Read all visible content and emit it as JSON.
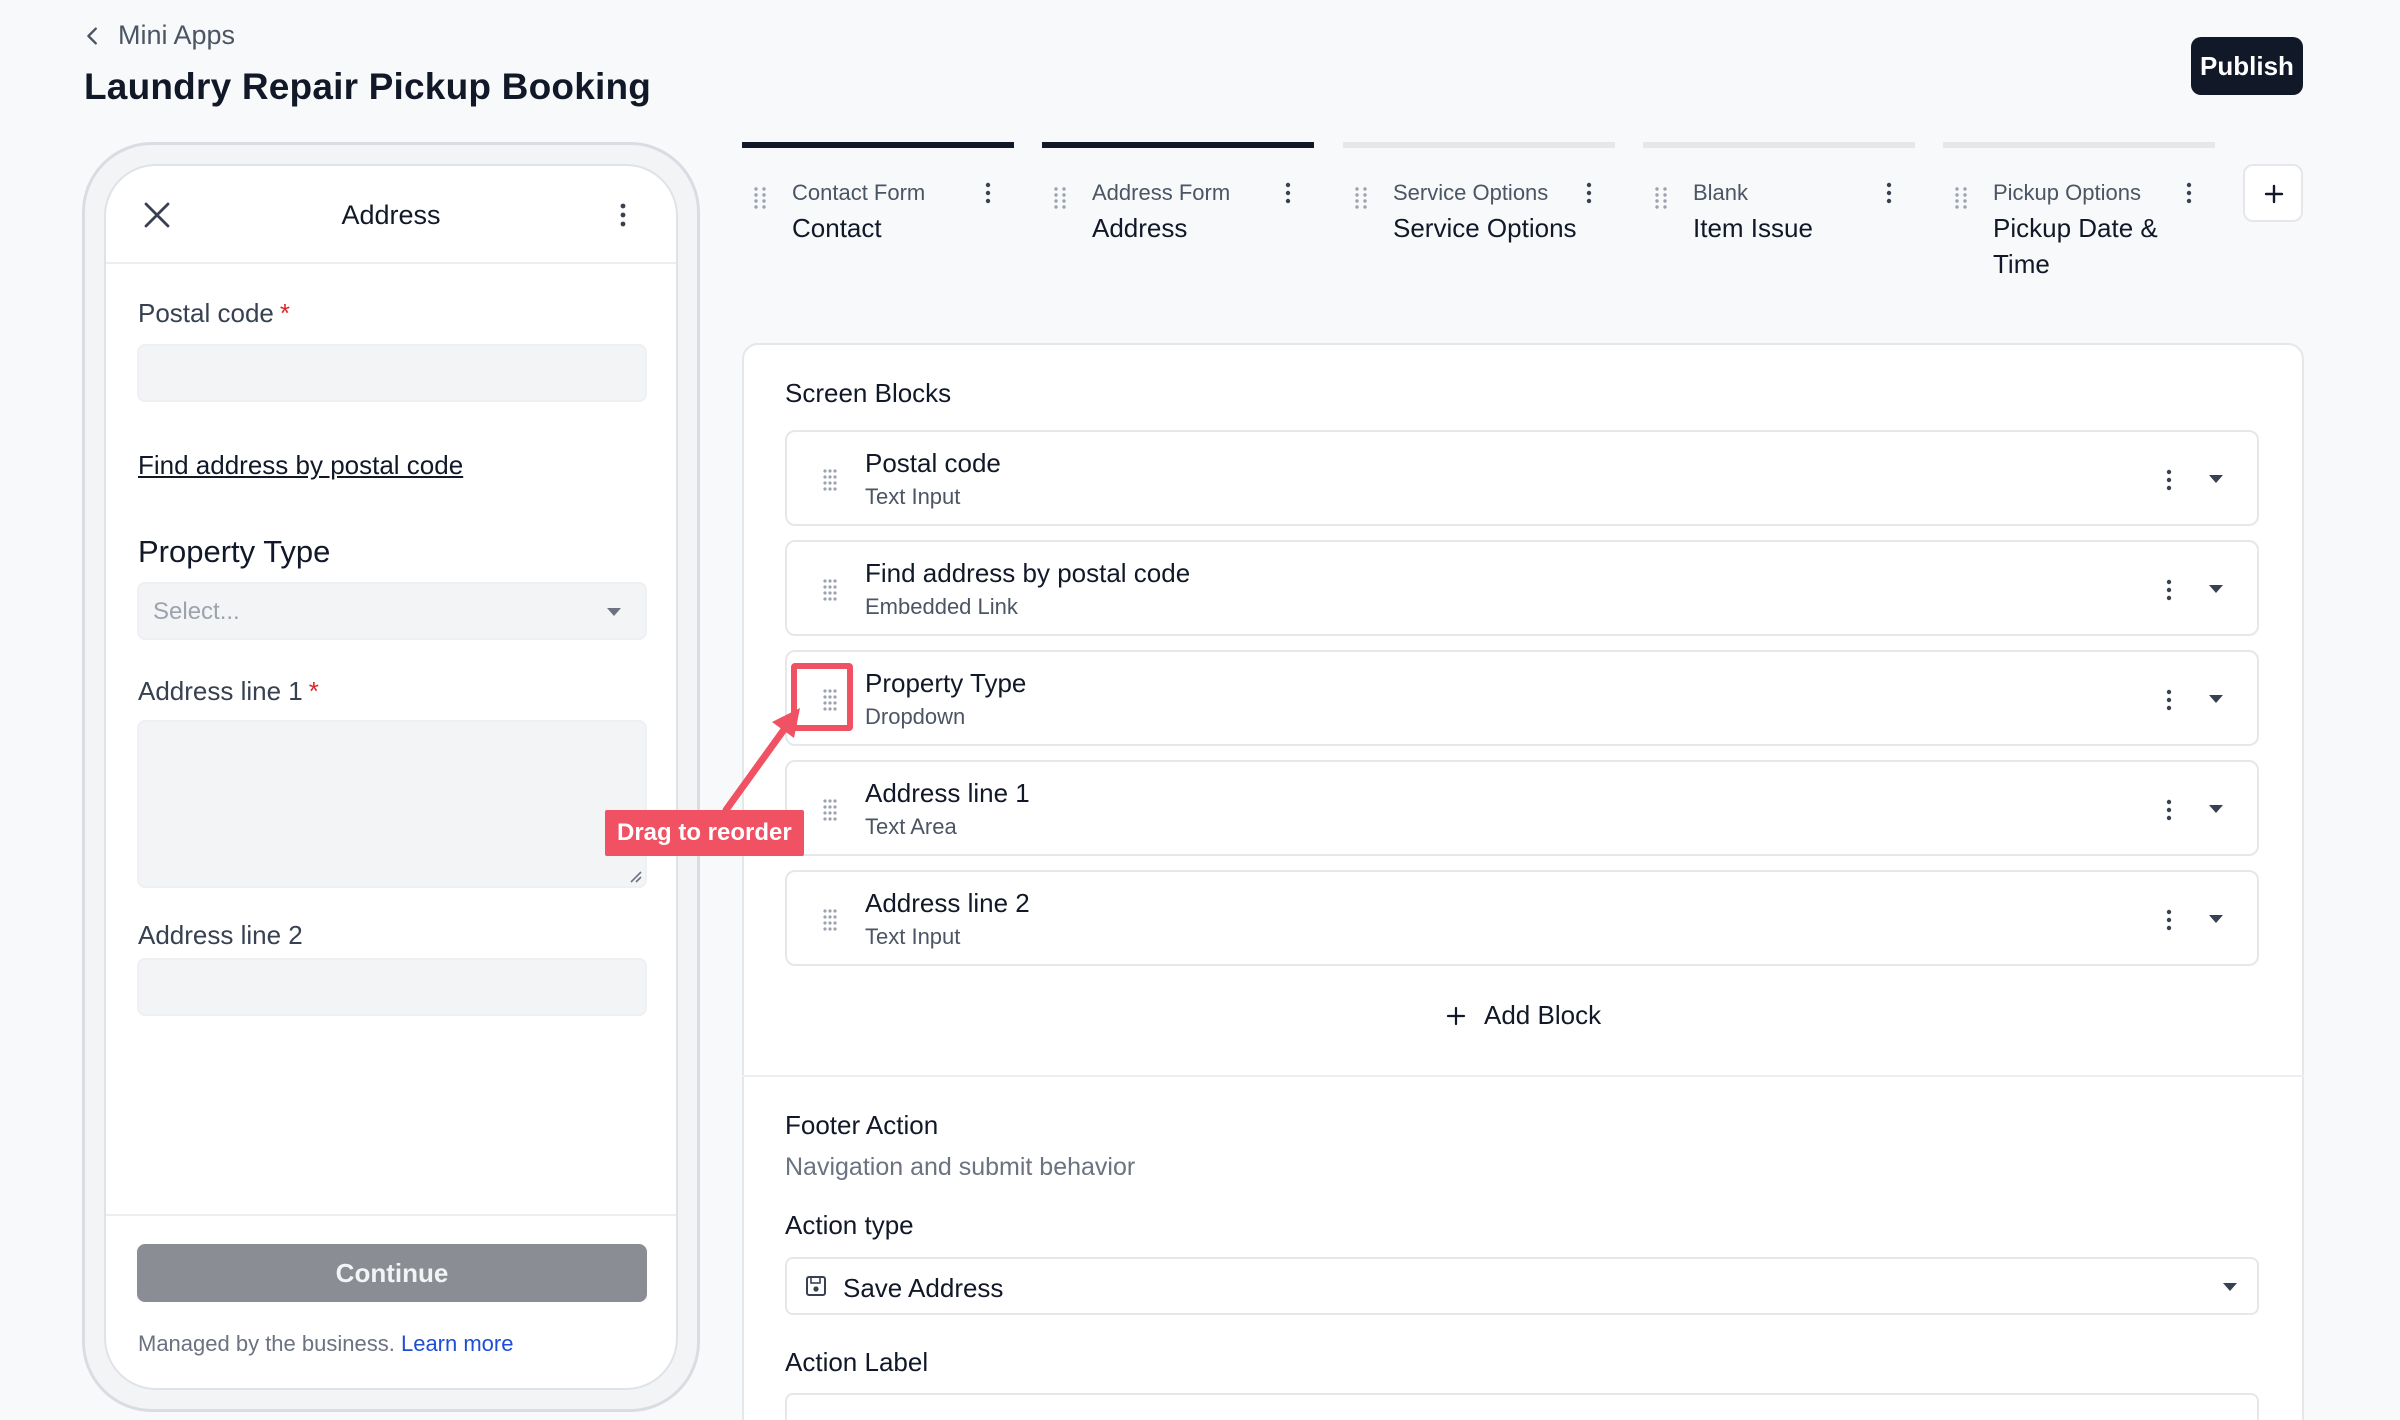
{
  "header": {
    "back_label": "Mini Apps",
    "title": "Laundry Repair Pickup Booking",
    "publish_label": "Publish"
  },
  "preview": {
    "screen_title": "Address",
    "postal_label": "Postal code",
    "required_mark": "*",
    "find_link": "Find address by postal code",
    "property_label": "Property Type",
    "property_placeholder": "Select...",
    "address1_label": "Address line 1",
    "address2_label": "Address line 2",
    "continue_label": "Continue",
    "managed_text": "Managed by the business.",
    "learn_more": "Learn more"
  },
  "tabs": [
    {
      "small": "Contact Form",
      "big": "Contact",
      "active": true
    },
    {
      "small": "Address Form",
      "big": "Address",
      "active": true
    },
    {
      "small": "Service Options",
      "big": "Service Options",
      "active": false
    },
    {
      "small": "Blank",
      "big": "Item Issue",
      "active": false
    },
    {
      "small": "Pickup Options",
      "big": "Pickup Date & Time",
      "active": false
    }
  ],
  "panel": {
    "blocks_title": "Screen Blocks",
    "blocks": [
      {
        "title": "Postal code",
        "type": "Text Input"
      },
      {
        "title": "Find address by postal code",
        "type": "Embedded Link"
      },
      {
        "title": "Property Type",
        "type": "Dropdown"
      },
      {
        "title": "Address line 1",
        "type": "Text Area"
      },
      {
        "title": "Address line 2",
        "type": "Text Input"
      }
    ],
    "add_block": "Add Block",
    "footer_title": "Footer Action",
    "footer_subtitle": "Navigation and submit behavior",
    "action_type_label": "Action type",
    "action_type_value": "Save Address",
    "action_label_title": "Action Label"
  },
  "annotation": {
    "callout": "Drag to reorder",
    "color": "#f05264"
  }
}
